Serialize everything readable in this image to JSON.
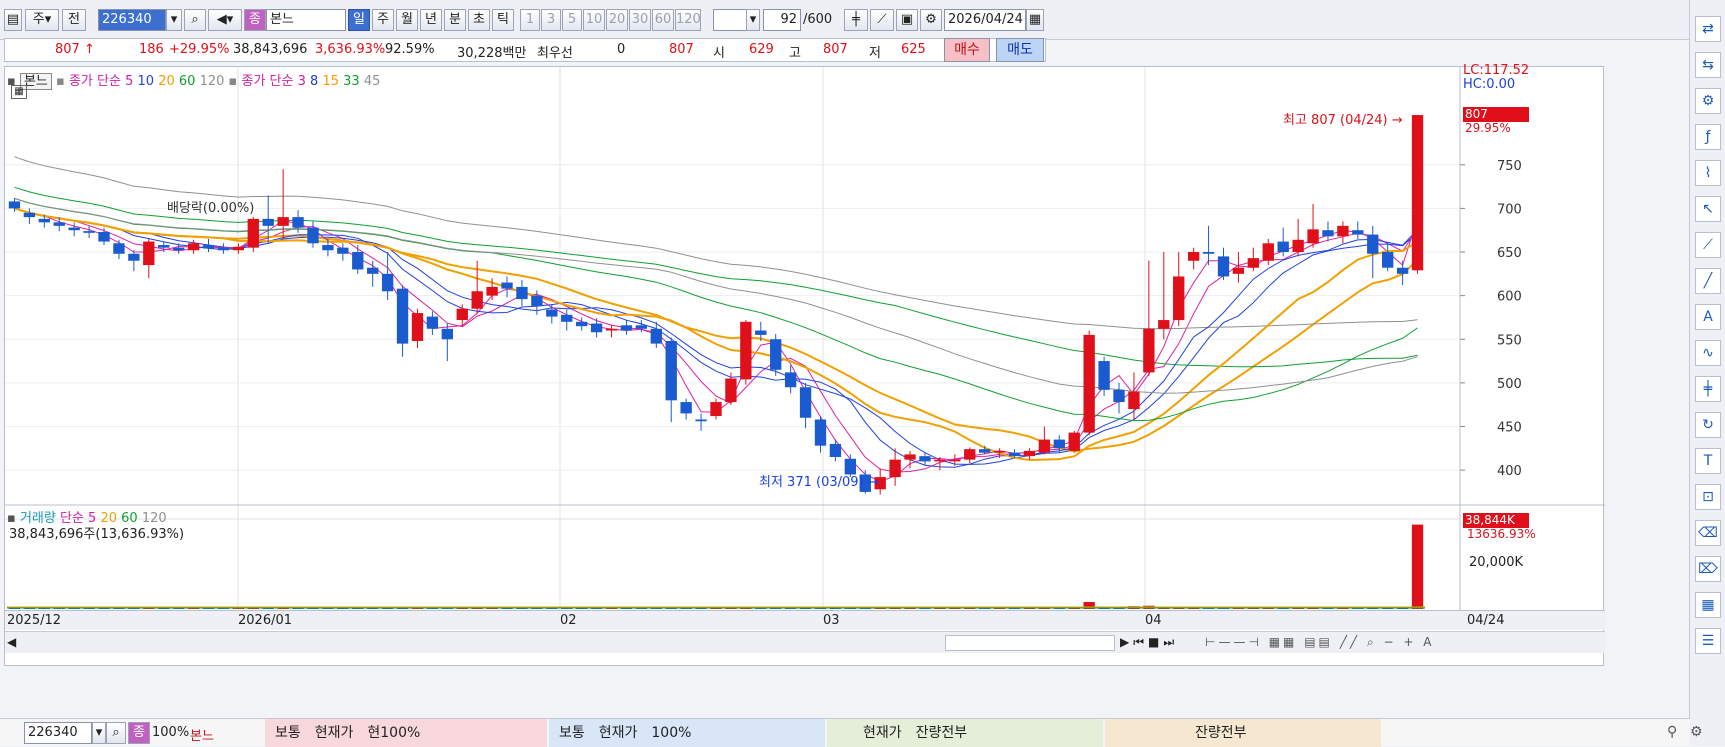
{
  "toolbar": {
    "mode": "주",
    "prev": "전",
    "code": "226340",
    "type_badge": "종",
    "name": "본느",
    "periods": [
      "일",
      "주",
      "월",
      "년",
      "분",
      "초",
      "틱"
    ],
    "active_period": "일",
    "minutes": [
      "1",
      "3",
      "5",
      "10",
      "20",
      "30",
      "60",
      "120"
    ],
    "count": "92",
    "count_total": "/600",
    "date": "2026/04/24"
  },
  "quote": {
    "price": "807",
    "change": "186",
    "change_pct": "+29.95%",
    "volume": "38,843,696",
    "vol_pct": "3,636.93%",
    "ratio": "92.59%",
    "amount": "30,228백만",
    "bid_label": "최우선",
    "bid_val": "0",
    "ask_val": "807",
    "open_label": "시",
    "open": "629",
    "high_label": "고",
    "high": "807",
    "low_label": "저",
    "low": "625",
    "buy": "매수",
    "sell": "매도"
  },
  "legend": {
    "name": "본느",
    "ma1_label": "종가 단순",
    "ma1": [
      "5",
      "10",
      "20",
      "60",
      "120"
    ],
    "ma2_label": "종가 단순",
    "ma2": [
      "3",
      "8",
      "15",
      "33",
      "45"
    ],
    "ma_colors": [
      "#e020a0",
      "#2040e0",
      "#f0a000",
      "#10a030",
      "#909090"
    ]
  },
  "price_axis": {
    "lc": "LC:117.52",
    "hc": "HC:0.00",
    "current": "807",
    "current_pct": "29.95%",
    "ticks": [
      "750",
      "700",
      "650",
      "600",
      "550",
      "500",
      "450",
      "400"
    ]
  },
  "annotations": {
    "high": "최고 807 (04/24)",
    "low": "최저 371 (03/09)",
    "dividend": "배당락(0.00%)"
  },
  "volume": {
    "label": "거래량",
    "ma_label": "단순",
    "ma": [
      "5",
      "20",
      "60",
      "120"
    ],
    "value": "38,843,696주(13,636.93%)",
    "current": "38,844K",
    "current_pct": "13636.93%",
    "tick": "20,000K"
  },
  "dates": [
    "2025/12",
    "2026/01",
    "02",
    "03",
    "04",
    "04/24"
  ],
  "chart_data": {
    "type": "candlestick",
    "title": "",
    "xlabel": "",
    "ylabel": "",
    "ylim": [
      360,
      830
    ],
    "candles": [
      [
        708,
        712,
        696,
        700
      ],
      [
        695,
        700,
        682,
        690
      ],
      [
        688,
        693,
        678,
        684
      ],
      [
        684,
        690,
        674,
        680
      ],
      [
        678,
        684,
        668,
        675
      ],
      [
        674,
        680,
        666,
        672
      ],
      [
        673,
        678,
        658,
        662
      ],
      [
        660,
        664,
        642,
        648
      ],
      [
        648,
        652,
        628,
        640
      ],
      [
        635,
        665,
        620,
        662
      ],
      [
        658,
        662,
        650,
        655
      ],
      [
        655,
        660,
        648,
        652
      ],
      [
        652,
        664,
        648,
        660
      ],
      [
        658,
        665,
        650,
        654
      ],
      [
        655,
        660,
        648,
        652
      ],
      [
        652,
        660,
        648,
        656
      ],
      [
        655,
        690,
        650,
        688
      ],
      [
        688,
        715,
        660,
        680
      ],
      [
        680,
        745,
        665,
        690
      ],
      [
        690,
        698,
        672,
        678
      ],
      [
        678,
        685,
        655,
        660
      ],
      [
        658,
        665,
        645,
        652
      ],
      [
        655,
        660,
        640,
        648
      ],
      [
        650,
        658,
        625,
        630
      ],
      [
        632,
        640,
        610,
        625
      ],
      [
        625,
        650,
        595,
        605
      ],
      [
        608,
        612,
        530,
        545
      ],
      [
        548,
        585,
        540,
        580
      ],
      [
        576,
        582,
        555,
        562
      ],
      [
        562,
        568,
        525,
        550
      ],
      [
        572,
        590,
        565,
        585
      ],
      [
        585,
        640,
        580,
        605
      ],
      [
        600,
        620,
        595,
        610
      ],
      [
        615,
        622,
        598,
        608
      ],
      [
        610,
        618,
        588,
        596
      ],
      [
        600,
        606,
        578,
        588
      ],
      [
        584,
        590,
        568,
        576
      ],
      [
        578,
        584,
        560,
        570
      ],
      [
        570,
        575,
        560,
        565
      ],
      [
        568,
        574,
        552,
        558
      ],
      [
        560,
        566,
        552,
        562
      ],
      [
        566,
        572,
        555,
        560
      ],
      [
        566,
        572,
        558,
        562
      ],
      [
        562,
        570,
        540,
        545
      ],
      [
        548,
        552,
        455,
        480
      ],
      [
        478,
        482,
        458,
        465
      ],
      [
        458,
        465,
        445,
        456
      ],
      [
        462,
        482,
        458,
        478
      ],
      [
        478,
        512,
        475,
        505
      ],
      [
        504,
        572,
        498,
        570
      ],
      [
        560,
        570,
        548,
        555
      ],
      [
        550,
        556,
        508,
        515
      ],
      [
        512,
        520,
        488,
        495
      ],
      [
        495,
        500,
        448,
        460
      ],
      [
        458,
        462,
        420,
        428
      ],
      [
        430,
        435,
        410,
        415
      ],
      [
        413,
        418,
        392,
        395
      ],
      [
        395,
        400,
        373,
        375
      ],
      [
        378,
        402,
        372,
        392
      ],
      [
        392,
        425,
        382,
        412
      ],
      [
        412,
        422,
        402,
        418
      ],
      [
        416,
        420,
        405,
        410
      ],
      [
        410,
        415,
        400,
        412
      ],
      [
        410,
        418,
        405,
        412
      ],
      [
        412,
        426,
        408,
        424
      ],
      [
        424,
        428,
        418,
        420
      ],
      [
        420,
        425,
        414,
        422
      ],
      [
        420,
        424,
        414,
        416
      ],
      [
        416,
        425,
        412,
        422
      ],
      [
        420,
        450,
        418,
        435
      ],
      [
        435,
        440,
        420,
        425
      ],
      [
        422,
        445,
        420,
        443
      ],
      [
        443,
        560,
        440,
        555
      ],
      [
        525,
        530,
        485,
        492
      ],
      [
        492,
        500,
        465,
        478
      ],
      [
        470,
        512,
        458,
        490
      ],
      [
        512,
        640,
        508,
        562
      ],
      [
        562,
        650,
        550,
        572
      ],
      [
        572,
        650,
        565,
        622
      ],
      [
        640,
        655,
        630,
        650
      ],
      [
        650,
        680,
        635,
        648
      ],
      [
        645,
        655,
        618,
        622
      ],
      [
        625,
        650,
        615,
        632
      ],
      [
        632,
        655,
        628,
        643
      ],
      [
        640,
        665,
        635,
        660
      ],
      [
        662,
        678,
        645,
        650
      ],
      [
        650,
        688,
        645,
        664
      ],
      [
        660,
        705,
        655,
        676
      ],
      [
        675,
        685,
        662,
        668
      ],
      [
        668,
        685,
        660,
        680
      ],
      [
        675,
        685,
        665,
        670
      ],
      [
        670,
        680,
        620,
        648
      ],
      [
        650,
        660,
        628,
        632
      ],
      [
        632,
        640,
        612,
        625
      ],
      [
        629,
        807,
        625,
        807
      ]
    ],
    "volumes": [
      0.2,
      0.2,
      0.2,
      0.2,
      0.2,
      0.2,
      0.2,
      0.2,
      0.2,
      0.2,
      0.2,
      0.2,
      0.2,
      0.2,
      0.2,
      0.2,
      0.2,
      0.2,
      0.4,
      0.2,
      0.2,
      0.2,
      0.2,
      0.2,
      0.2,
      0.2,
      0.2,
      0.2,
      0.2,
      0.2,
      0.2,
      0.3,
      0.2,
      0.2,
      0.2,
      0.2,
      0.2,
      0.2,
      0.2,
      0.2,
      0.2,
      0.2,
      0.2,
      0.2,
      0.5,
      0.2,
      0.2,
      0.2,
      0.5,
      0.5,
      0.4,
      0.3,
      0.2,
      0.2,
      0.2,
      0.2,
      0.2,
      0.2,
      0.2,
      0.2,
      0.2,
      0.2,
      0.2,
      0.2,
      0.2,
      0.2,
      0.2,
      0.2,
      0.2,
      0.2,
      0.2,
      0.2,
      3.2,
      1.0,
      0.6,
      1.3,
      1.5,
      0.8,
      0.7,
      0.6,
      0.5,
      0.4,
      0.4,
      0.4,
      0.4,
      0.4,
      0.4,
      0.4,
      0.4,
      0.4,
      0.4,
      0.4,
      0.4,
      0.4,
      38.8
    ]
  }
}
